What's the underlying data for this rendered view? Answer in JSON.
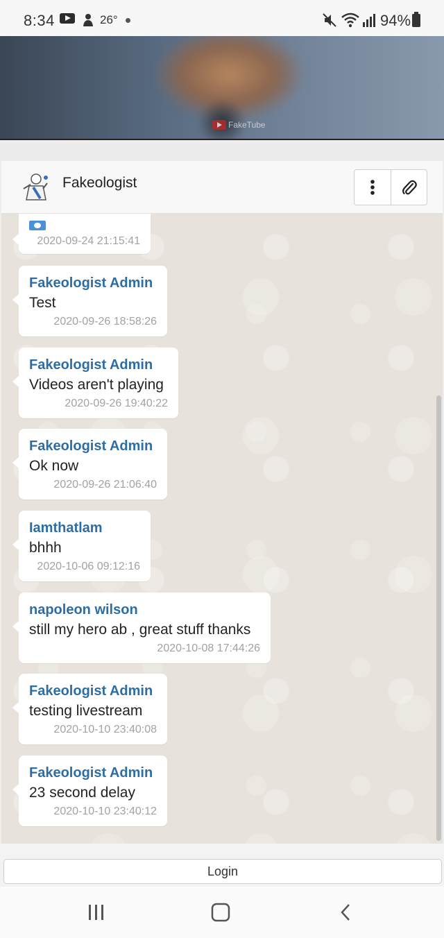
{
  "status_bar": {
    "time": "8:34",
    "temperature": "26°",
    "battery": "94%",
    "icons": [
      "youtube-icon",
      "person-icon",
      "dot-icon",
      "mute-icon",
      "wifi-icon",
      "signal-icon",
      "battery-icon"
    ]
  },
  "video": {
    "watermark": "FakeTube"
  },
  "header": {
    "title": "Fakeologist",
    "menu_icon": "vertical-dots-icon",
    "attach_icon": "paperclip-icon"
  },
  "messages": [
    {
      "author": "",
      "text": "",
      "time": "2020-09-24 21:15:41"
    },
    {
      "author": "Fakeologist Admin",
      "text": "Test",
      "time": "2020-09-26 18:58:26"
    },
    {
      "author": "Fakeologist Admin",
      "text": "Videos aren't playing",
      "time": "2020-09-26 19:40:22"
    },
    {
      "author": "Fakeologist Admin",
      "text": "Ok now",
      "time": "2020-09-26 21:06:40"
    },
    {
      "author": "Iamthatlam",
      "text": "bhhh",
      "time": "2020-10-06 09:12:16"
    },
    {
      "author": "napoleon wilson",
      "text": "still my hero ab , great stuff thanks",
      "time": "2020-10-08 17:44:26"
    },
    {
      "author": "Fakeologist Admin",
      "text": "testing livestream",
      "time": "2020-10-10 23:40:08"
    },
    {
      "author": "Fakeologist Admin",
      "text": "23 second delay",
      "time": "2020-10-10 23:40:12"
    }
  ],
  "login": {
    "label": "Login"
  },
  "nav": {
    "icons": [
      "recent-apps-icon",
      "home-icon",
      "back-icon"
    ]
  },
  "colors": {
    "author": "#2e6da4",
    "chat_background": "#e7e3dc",
    "bubble": "#ffffff",
    "timestamp": "#a2a2a2"
  }
}
